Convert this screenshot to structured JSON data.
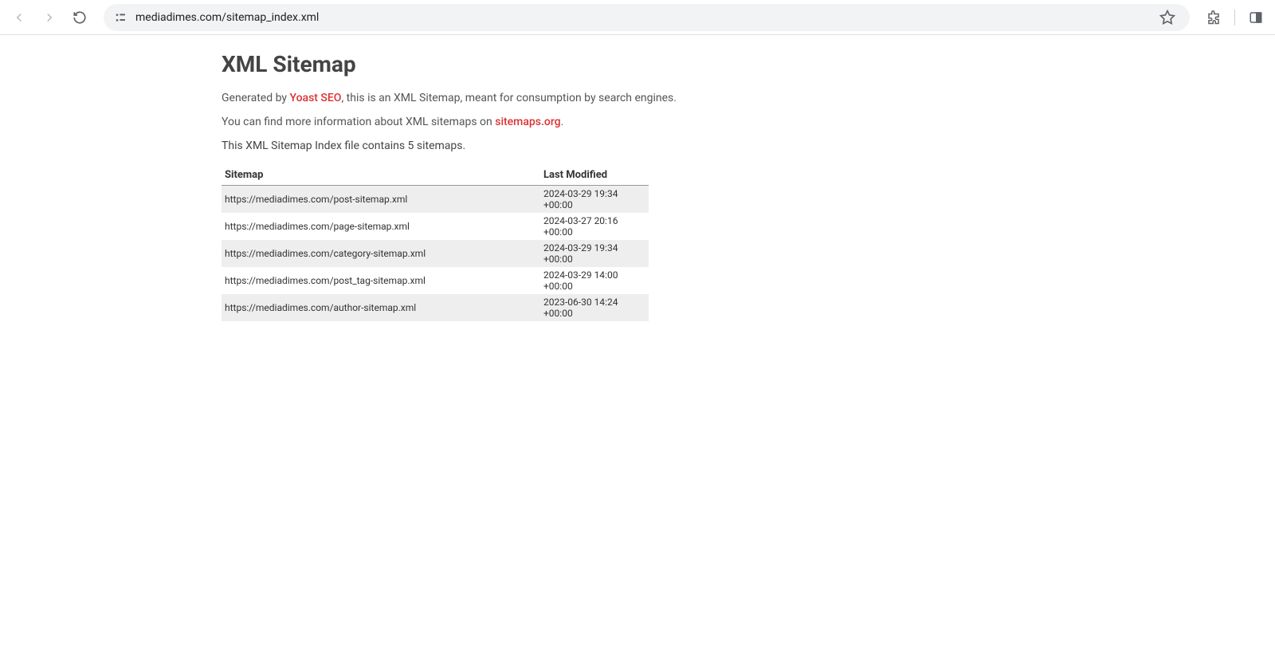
{
  "browser": {
    "url": "mediadimes.com/sitemap_index.xml"
  },
  "page": {
    "title": "XML Sitemap",
    "generated_prefix": "Generated by ",
    "generated_link": "Yoast SEO",
    "generated_suffix": ", this is an XML Sitemap, meant for consumption by search engines.",
    "moreinfo_prefix": "You can find more information about XML sitemaps on ",
    "moreinfo_link": "sitemaps.org",
    "moreinfo_suffix": ".",
    "count_text": "This XML Sitemap Index file contains 5 sitemaps.",
    "table": {
      "header_sitemap": "Sitemap",
      "header_modified": "Last Modified",
      "rows": [
        {
          "url": "https://mediadimes.com/post-sitemap.xml",
          "modified": "2024-03-29 19:34 +00:00"
        },
        {
          "url": "https://mediadimes.com/page-sitemap.xml",
          "modified": "2024-03-27 20:16 +00:00"
        },
        {
          "url": "https://mediadimes.com/category-sitemap.xml",
          "modified": "2024-03-29 19:34 +00:00"
        },
        {
          "url": "https://mediadimes.com/post_tag-sitemap.xml",
          "modified": "2024-03-29 14:00 +00:00"
        },
        {
          "url": "https://mediadimes.com/author-sitemap.xml",
          "modified": "2023-06-30 14:24 +00:00"
        }
      ]
    }
  }
}
